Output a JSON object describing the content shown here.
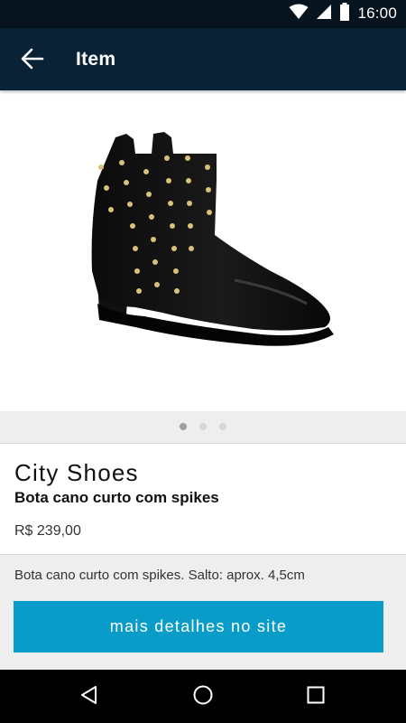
{
  "status_bar": {
    "time": "16:00",
    "icons": [
      "wifi-icon",
      "cell-signal-icon",
      "battery-icon"
    ]
  },
  "app_bar": {
    "title": "Item",
    "back_icon": "arrow-left-icon"
  },
  "gallery": {
    "image": "black ankle boot with gold studs",
    "page_count": 3,
    "active_page": 1
  },
  "product": {
    "brand": "City Shoes",
    "name": "Bota cano curto com spikes",
    "price": "R$ 239,00",
    "description": "Bota cano curto com spikes. Salto: aprox. 4,5cm"
  },
  "cta": {
    "label": "mais detalhes no site",
    "color": "#0a9cc9"
  },
  "nav_bar": {
    "icons": [
      "back-triangle-icon",
      "home-circle-icon",
      "recents-square-icon"
    ]
  },
  "colors": {
    "status_bar": "#05141f",
    "app_bar": "#0a2236",
    "background": "#eeeeee"
  }
}
